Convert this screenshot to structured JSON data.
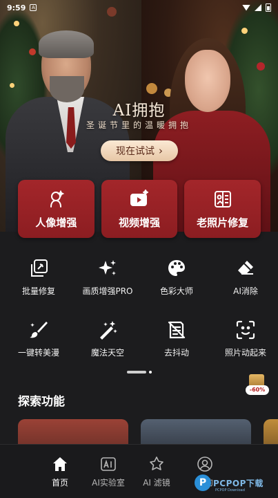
{
  "status": {
    "time": "9:59",
    "sim": "A"
  },
  "hero": {
    "title": "AI拥抱",
    "subtitle": "圣诞节里的温暖拥抱",
    "cta": "现在试试",
    "cta_chevron": "›"
  },
  "tiles": [
    {
      "label": "人像增强",
      "icon": "portrait-sparkle-icon"
    },
    {
      "label": "视频增强",
      "icon": "video-sparkle-icon"
    },
    {
      "label": "老照片修复",
      "icon": "old-photo-icon"
    }
  ],
  "tools": [
    {
      "label": "批量修复",
      "icon": "batch-repair-icon"
    },
    {
      "label": "画质增强PRO",
      "icon": "sparkles-icon"
    },
    {
      "label": "色彩大师",
      "icon": "palette-icon"
    },
    {
      "label": "AI消除",
      "icon": "eraser-icon"
    },
    {
      "label": "一键转美漫",
      "icon": "brush-icon"
    },
    {
      "label": "魔法天空",
      "icon": "magic-wand-icon"
    },
    {
      "label": "去抖动",
      "icon": "deshake-icon"
    },
    {
      "label": "照片动起来",
      "icon": "face-scan-icon"
    }
  ],
  "promo": {
    "discount": "-60%"
  },
  "section": {
    "title": "探索功能"
  },
  "nav": [
    {
      "label": "首页",
      "icon": "home-icon",
      "active": true
    },
    {
      "label": "AI实验室",
      "icon": "ai-lab-icon",
      "active": false
    },
    {
      "label": "AI 滤镜",
      "icon": "filter-icon",
      "active": false
    },
    {
      "label": "我的",
      "icon": "profile-icon",
      "active": false
    }
  ],
  "watermark": {
    "letter": "P",
    "text": "PCPOP下载",
    "small": "PCPOP Download"
  },
  "colors": {
    "accent": "#9b2226",
    "background": "#1c1c1e",
    "cta_bg": "#f3dcc1"
  }
}
